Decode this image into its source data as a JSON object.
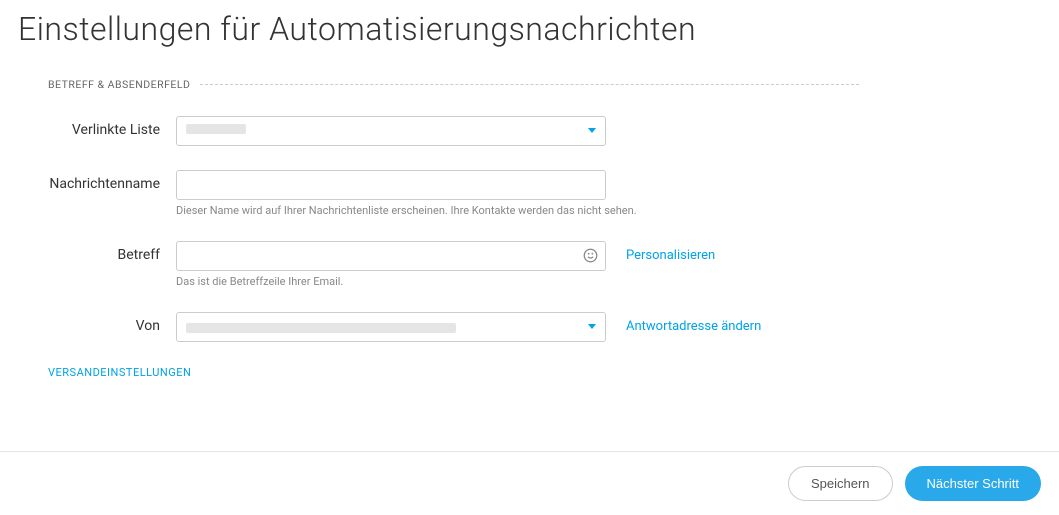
{
  "header": {
    "title": "Einstellungen für Automatisierungsnachrichten"
  },
  "section": {
    "title": "BETREFF & ABSENDERFELD"
  },
  "fields": {
    "linked_list": {
      "label": "Verlinkte Liste",
      "value": ""
    },
    "message_name": {
      "label": "Nachrichtenname",
      "value": "",
      "help": "Dieser Name wird auf Ihrer Nachrichtenliste erscheinen. Ihre Kontakte werden das nicht sehen."
    },
    "subject": {
      "label": "Betreff",
      "value": "",
      "help": "Das ist die Betreffzeile Ihrer Email.",
      "personalize_link": "Personalisieren"
    },
    "from": {
      "label": "Von",
      "value": "",
      "reply_link": "Antwortadresse ändern"
    }
  },
  "delivery_settings_link": "VERSANDEINSTELLUNGEN",
  "footer": {
    "save": "Speichern",
    "next": "Nächster Schritt"
  }
}
